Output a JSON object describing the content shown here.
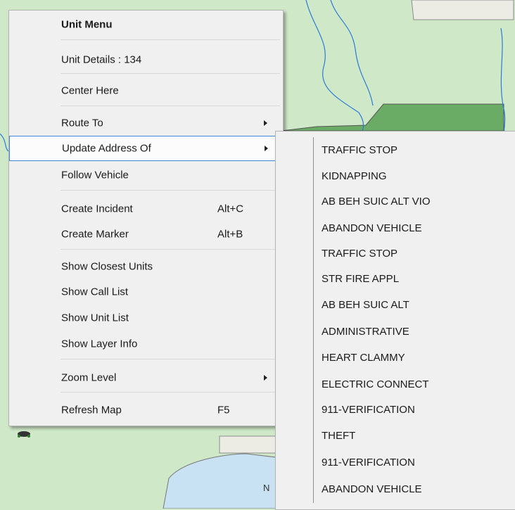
{
  "map": {
    "label": "N",
    "colors": {
      "land": "#cfe8c8",
      "water": "#c9e2f3",
      "building": "#ecebe4",
      "park": "#6aab66",
      "river": "#2c7bd6"
    }
  },
  "unit_menu": {
    "header": "Unit Menu",
    "unit_details": "Unit Details : 134",
    "center_here": "Center Here",
    "route_to": "Route To",
    "update_address_of": "Update Address Of",
    "follow_vehicle": "Follow Vehicle",
    "create_incident": "Create Incident",
    "create_incident_shortcut": "Alt+C",
    "create_marker": "Create Marker",
    "create_marker_shortcut": "Alt+B",
    "show_closest_units": "Show Closest Units",
    "show_call_list": "Show Call List",
    "show_unit_list": "Show Unit List",
    "show_layer_info": "Show Layer Info",
    "zoom_level": "Zoom Level",
    "refresh_map": "Refresh Map",
    "refresh_map_shortcut": "F5"
  },
  "sub_menu": {
    "items": [
      "TRAFFIC STOP",
      "KIDNAPPING",
      "AB BEH SUIC ALT VIO",
      "ABANDON VEHICLE",
      "TRAFFIC STOP",
      "STR FIRE APPL",
      "AB BEH SUIC ALT",
      "ADMINISTRATIVE",
      "HEART CLAMMY",
      "ELECTRIC CONNECT",
      "911-VERIFICATION",
      "THEFT",
      "911-VERIFICATION",
      "ABANDON VEHICLE"
    ]
  }
}
